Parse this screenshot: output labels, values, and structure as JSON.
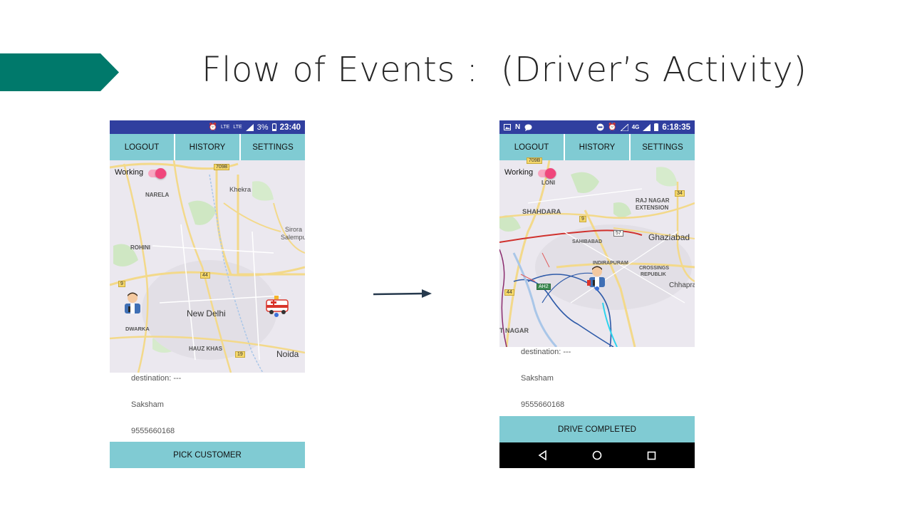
{
  "slide": {
    "title": "Flow of Events :  (Driver’s Activity)",
    "accent_color": "#00796b"
  },
  "phone_before": {
    "status": {
      "time": "23:40",
      "battery": "3%",
      "icons": [
        "alarm-icon",
        "volte-icon",
        "lte-icon",
        "signal-icon",
        "battery-icon"
      ],
      "volte": "LTE",
      "lte": "LTE"
    },
    "nav": {
      "logout": "LOGOUT",
      "history": "HISTORY",
      "settings": "SETTINGS"
    },
    "map": {
      "working_label": "Working",
      "places": [
        "NARELA",
        "Khekra",
        "Sirora",
        "Salempu",
        "ROHINI",
        "New Delhi",
        "DWARKA",
        "HAUZ KHAS",
        "Noida"
      ],
      "road_shields": [
        "709B",
        "9",
        "44",
        "19"
      ],
      "markers": [
        "driver-icon",
        "ambulance-icon"
      ]
    },
    "info": {
      "destination": "destination: ---",
      "name": "Saksham",
      "phone": "9555660168"
    },
    "action": "PICK CUSTOMER"
  },
  "phone_after": {
    "status": {
      "time": "6:18:35",
      "network": "4G",
      "icons": [
        "image-icon",
        "n-icon",
        "chat-icon",
        "dnd-icon",
        "alarm-icon",
        "signal-icon",
        "battery-icon"
      ]
    },
    "nav": {
      "logout": "LOGOUT",
      "history": "HISTORY",
      "settings": "SETTINGS"
    },
    "map": {
      "working_label": "Working",
      "places": [
        "LONI",
        "SHAHDARA",
        "RAJ NAGAR",
        "EXTENSION",
        "Ghaziabad",
        "SAHIBABAD",
        "INDIRAPURAM",
        "CROSSINGS",
        "REPUBLIK",
        "Chhapra",
        "T NAGAR"
      ],
      "road_shields": [
        "709B",
        "9",
        "34",
        "57",
        "AH2",
        "44"
      ],
      "markers": [
        "driver-icon"
      ]
    },
    "info": {
      "destination": "destination: ---",
      "name": "Saksham",
      "phone": "9555660168"
    },
    "action": "DRIVE COMPLETED",
    "system_nav": [
      "back-icon",
      "home-icon",
      "recents-icon"
    ]
  },
  "colors": {
    "status_bar": "#303f9f",
    "button": "#80cbd3",
    "toggle_on": "#f0467c",
    "map_bg": "#ebe8ef",
    "road": "#f3d98a"
  }
}
